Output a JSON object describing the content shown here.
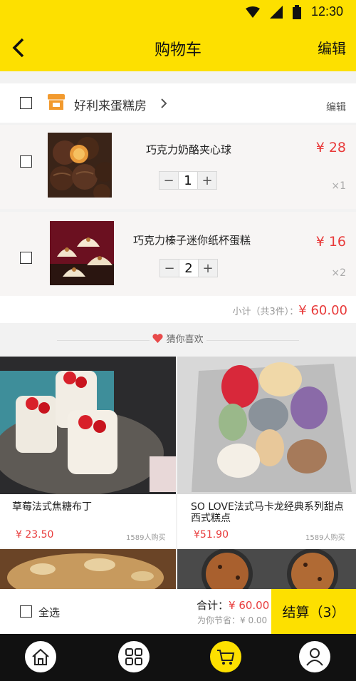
{
  "status_bar": {
    "time": "12:30"
  },
  "header": {
    "title": "购物车",
    "edit_label": "编辑"
  },
  "store": {
    "name": "好利来蛋糕房",
    "edit_label": "编辑"
  },
  "cart_items": [
    {
      "name": "巧克力奶酪夹心球",
      "price": "¥ 28",
      "quantity": "1",
      "qty_label": "×1"
    },
    {
      "name": "巧克力榛子迷你纸杯蛋糕",
      "price": "¥ 16",
      "quantity": "2",
      "qty_label": "×2"
    }
  ],
  "stepper": {
    "minus": "−",
    "plus": "+"
  },
  "subtotal": {
    "label": "小计（共3件）：",
    "amount": "¥ 60.00"
  },
  "recommend": {
    "label": "猜你喜欢"
  },
  "products": [
    {
      "name": "草莓法式焦糖布丁",
      "price": "¥ 23.50",
      "sold": "1589人购买"
    },
    {
      "name": "SO LOVE法式马卡龙经典系列甜点西式糕点",
      "price": "¥51.90",
      "sold": "1589人购买"
    }
  ],
  "checkout": {
    "select_all_label": "全选",
    "total_label": "合计：",
    "total_amount": "¥ 60.00",
    "saved_text": "为你节省：¥ 0.00",
    "button_label": "结算（3）"
  },
  "colors": {
    "accent": "#fde000",
    "price": "#e83a3a",
    "store_icon": "#f29a2e"
  },
  "tab_icons": [
    "home-icon",
    "grid-icon",
    "cart-icon",
    "user-icon"
  ]
}
